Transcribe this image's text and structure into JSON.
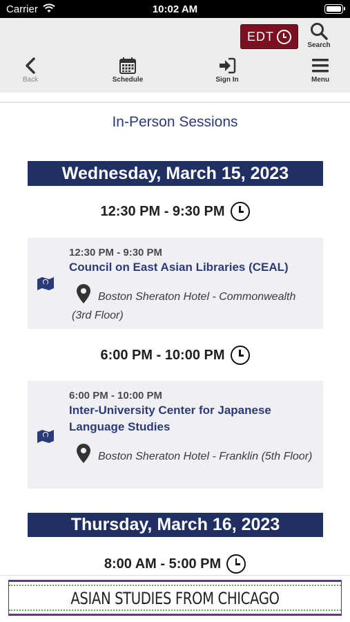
{
  "status_bar": {
    "carrier": "Carrier",
    "time": "10:02 AM"
  },
  "header": {
    "timezone_badge": "EDT",
    "search_label": "Search",
    "nav": [
      {
        "label": "Back",
        "icon": "chevron-left-icon"
      },
      {
        "label": "Schedule",
        "icon": "calendar-icon"
      },
      {
        "label": "Sign In",
        "icon": "sign-in-icon"
      },
      {
        "label": "Menu",
        "icon": "hamburger-icon"
      }
    ]
  },
  "page": {
    "title": "In-Person Sessions"
  },
  "days": [
    {
      "date": "Wednesday, March 15, 2023",
      "slots": [
        {
          "time": "12:30 PM - 9:30 PM",
          "session": {
            "time": "12:30 PM - 9:30 PM",
            "title": "Council on East Asian Libraries (CEAL)",
            "location": "Boston Sheraton Hotel - Commonwealth (3rd Floor)"
          }
        },
        {
          "time": "6:00 PM - 10:00 PM",
          "session": {
            "time": "6:00 PM - 10:00 PM",
            "title": "Inter-University Center for Japanese Language Studies",
            "location": "Boston Sheraton Hotel - Franklin (5th Floor)"
          }
        }
      ]
    },
    {
      "date": "Thursday, March 16, 2023",
      "slots": [
        {
          "time": "8:00 AM - 5:00 PM"
        }
      ]
    }
  ],
  "footer_ad": {
    "text": "ASIAN STUDIES FROM CHICAGO"
  },
  "colors": {
    "brand_navy": "#213063",
    "title_blue": "#2b3a78",
    "badge_maroon": "#7b1020",
    "card_bg": "#f0f0f4",
    "header_bg": "#ececec"
  }
}
